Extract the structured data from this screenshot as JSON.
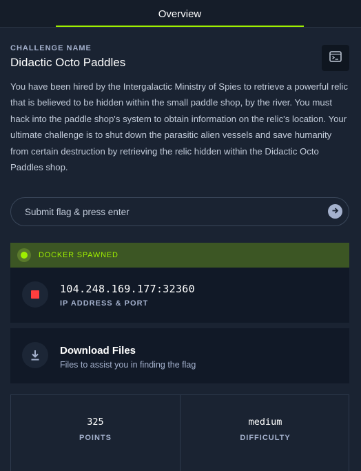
{
  "tabs": {
    "overview_label": "Overview"
  },
  "challenge": {
    "name_label": "CHALLENGE NAME",
    "name": "Didactic Octo Paddles",
    "description": "You have been hired by the Intergalactic Ministry of Spies to retrieve a powerful relic that is believed to be hidden within the small paddle shop, by the river. You must hack into the paddle shop's system to obtain information on the relic's location. Your ultimate challenge is to shut down the parasitic alien vessels and save humanity from certain destruction by retrieving the relic hidden within the Didactic Octo Paddles shop."
  },
  "flag": {
    "placeholder": "Submit flag & press enter",
    "value": ""
  },
  "docker": {
    "status": "DOCKER SPAWNED",
    "ip": "104.248.169.177:32360",
    "ip_label": "IP ADDRESS & PORT"
  },
  "download": {
    "title": "Download Files",
    "subtitle": "Files to assist you in finding the flag"
  },
  "stats": {
    "points_value": "325",
    "points_label": "POINTS",
    "difficulty_value": "medium",
    "difficulty_label": "DIFFICULTY"
  },
  "colors": {
    "accent": "#9fef00",
    "background": "#1a2332",
    "card": "#111927",
    "stop": "#ff3e3e",
    "docker_bar": "#3c5624"
  },
  "icons": {
    "console": "terminal-icon",
    "submit": "arrow-right-icon",
    "status": "status-dot-icon",
    "stop": "stop-icon",
    "download": "download-icon"
  }
}
